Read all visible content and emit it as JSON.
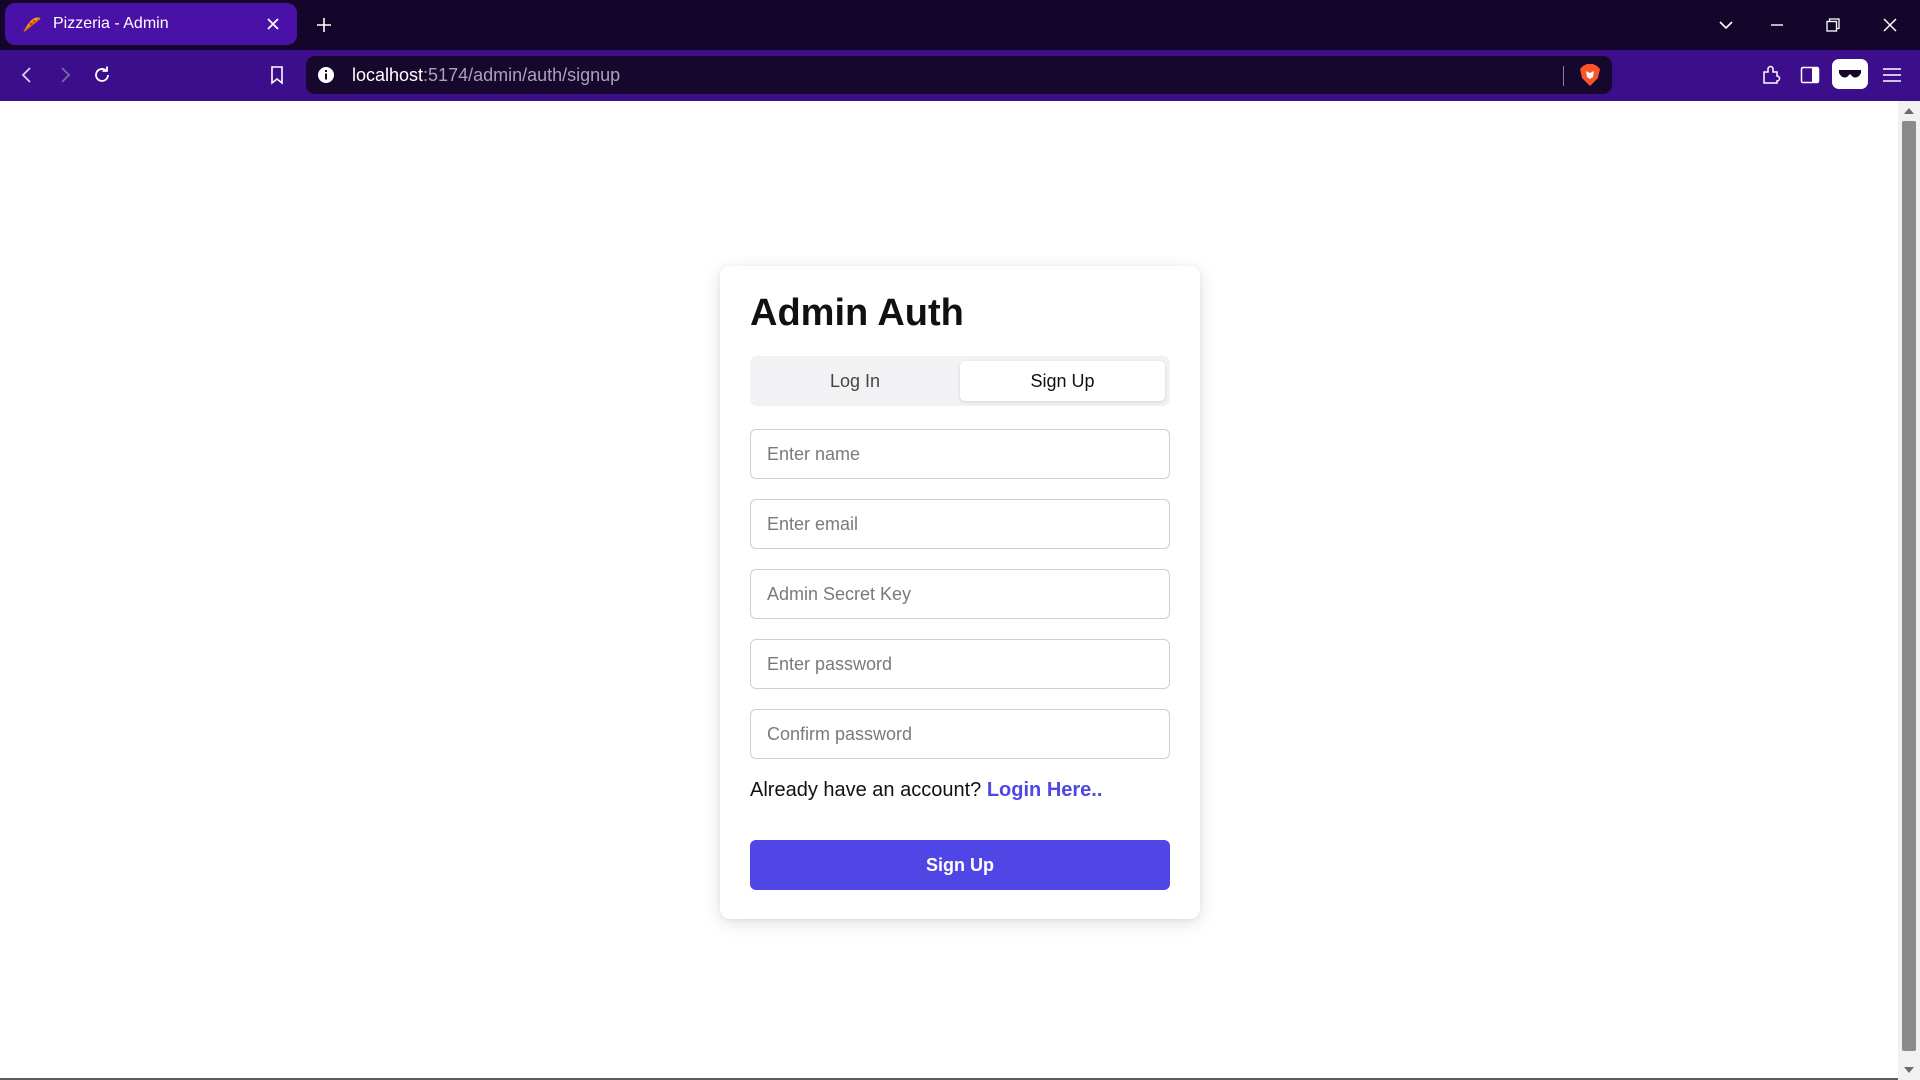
{
  "browser": {
    "tab_title": "Pizzeria - Admin",
    "url_host": "localhost",
    "url_path": ":5174/admin/auth/signup"
  },
  "colors": {
    "titlebar": "#14062b",
    "active_tab": "#4a11a8",
    "toolbar": "#3d0e8c",
    "accent": "#4f46e5"
  },
  "icons": [
    "pizza-favicon-icon",
    "close-icon",
    "plus-icon",
    "chevron-down-icon",
    "minimize-icon",
    "restore-icon",
    "back-icon",
    "forward-icon",
    "reload-icon",
    "bookmark-icon",
    "info-icon",
    "brave-shield-icon",
    "extensions-icon",
    "sidebar-icon",
    "wallet-icon",
    "menu-icon"
  ],
  "auth": {
    "title": "Admin Auth",
    "tabs": {
      "login": "Log In",
      "signup": "Sign Up",
      "active": "signup"
    },
    "fields": {
      "name_placeholder": "Enter name",
      "email_placeholder": "Enter email",
      "secret_placeholder": "Admin Secret Key",
      "password_placeholder": "Enter password",
      "confirm_placeholder": "Confirm password"
    },
    "already_text": "Already have an account?",
    "login_link": "Login Here..",
    "submit_label": "Sign Up"
  }
}
